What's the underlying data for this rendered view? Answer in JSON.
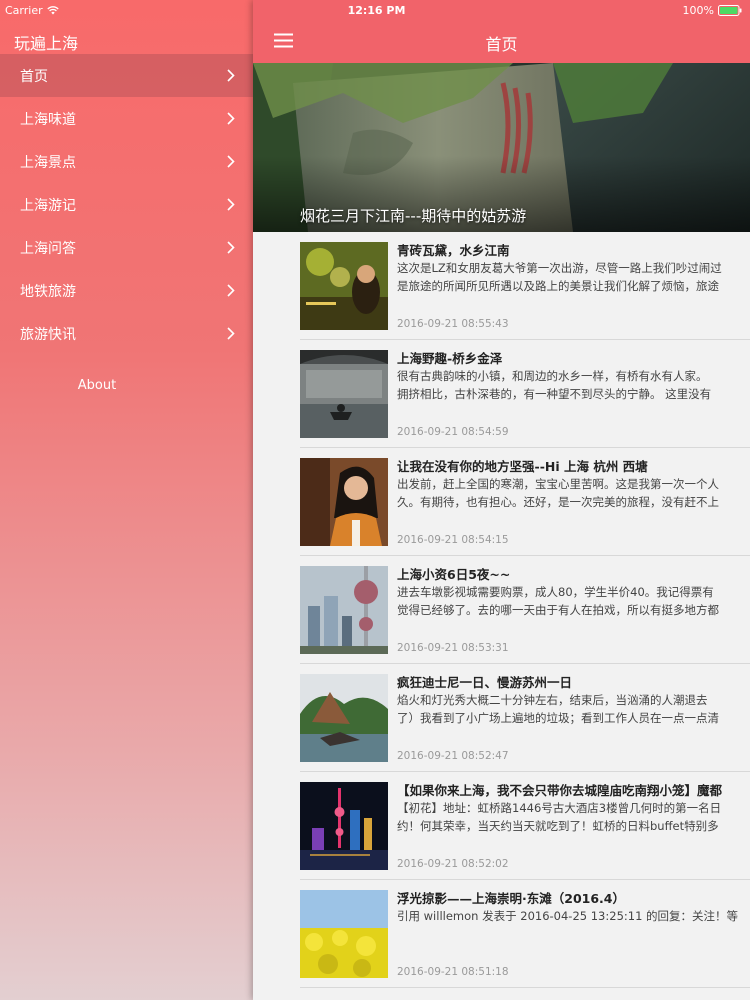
{
  "status": {
    "carrier": "Carrier",
    "time": "12:16 PM",
    "battery": "100%"
  },
  "sidebar": {
    "title": "玩遍上海",
    "items": [
      {
        "label": "首页",
        "active": true
      },
      {
        "label": "上海味道"
      },
      {
        "label": "上海景点"
      },
      {
        "label": "上海游记"
      },
      {
        "label": "上海问答"
      },
      {
        "label": "地铁旅游"
      },
      {
        "label": "旅游快讯"
      }
    ],
    "about": "About"
  },
  "header": {
    "title": "首页"
  },
  "banner": {
    "caption": "烟花三月下江南---期待中的姑苏游"
  },
  "articles": [
    {
      "title": "青砖瓦黛，水乡江南",
      "excerpt1": "这次是LZ和女朋友葛大爷第一次出游，尽管一路上我们吵过闹过",
      "excerpt2": "是旅途的所闻所见所遇以及路上的美景让我们化解了烦恼，旅途",
      "time": "2016-09-21 08:55:43"
    },
    {
      "title": "上海野趣-桥乡金泽",
      "excerpt1": "很有古典韵味的小镇，和周边的水乡一样，有桥有水有人家。",
      "excerpt2": "拥挤相比，古朴深巷的，有一种望不到尽头的宁静。 这里没有",
      "time": "2016-09-21 08:54:59"
    },
    {
      "title": "让我在没有你的地方坚强--Hi 上海 杭州  西塘",
      "excerpt1": "出发前，赶上全国的寒潮，宝宝心里苦啊。这是我第一次一个人",
      "excerpt2": "久。有期待，也有担心。还好，是一次完美的旅程，没有赶不上",
      "time": "2016-09-21 08:54:15"
    },
    {
      "title": "上海小资6日5夜~~",
      "excerpt1": "进去车墩影视城需要购票，成人80，学生半价40。我记得票有",
      "excerpt2": "觉得已经够了。去的哪一天由于有人在拍戏，所以有挺多地方都",
      "time": "2016-09-21 08:53:31"
    },
    {
      "title": "疯狂迪士尼一日、慢游苏州一日",
      "excerpt1": "焰火和灯光秀大概二十分钟左右，结束后，当汹涌的人潮退去",
      "excerpt2": "了）我看到了小广场上遍地的垃圾；看到工作人员在一点一点清",
      "time": "2016-09-21 08:52:47"
    },
    {
      "title": "【如果你来上海，我不会只带你去城隍庙吃南翔小笼】魔都",
      "excerpt1": "【初花】地址：虹桥路1446号古大酒店3楼曾几何时的第一名日",
      "excerpt2": "约！何其荣幸，当天约当天就吃到了！虹桥的日料buffet特别多",
      "time": "2016-09-21 08:52:02"
    },
    {
      "title": "浮光掠影——上海崇明·东滩（2016.4）",
      "excerpt1": "引用 willlemon 发表于 2016-04-25 13:25:11 的回复：关注！等",
      "excerpt2": "",
      "time": "2016-09-21 08:51:18"
    }
  ],
  "icons": {
    "wifi": "wifi-icon",
    "battery": "battery-icon",
    "menu": "hamburger-icon",
    "chevron": "chevron-right-icon"
  },
  "colors": {
    "header": "#f1636a",
    "sidebar_top": "#f86a6a"
  }
}
